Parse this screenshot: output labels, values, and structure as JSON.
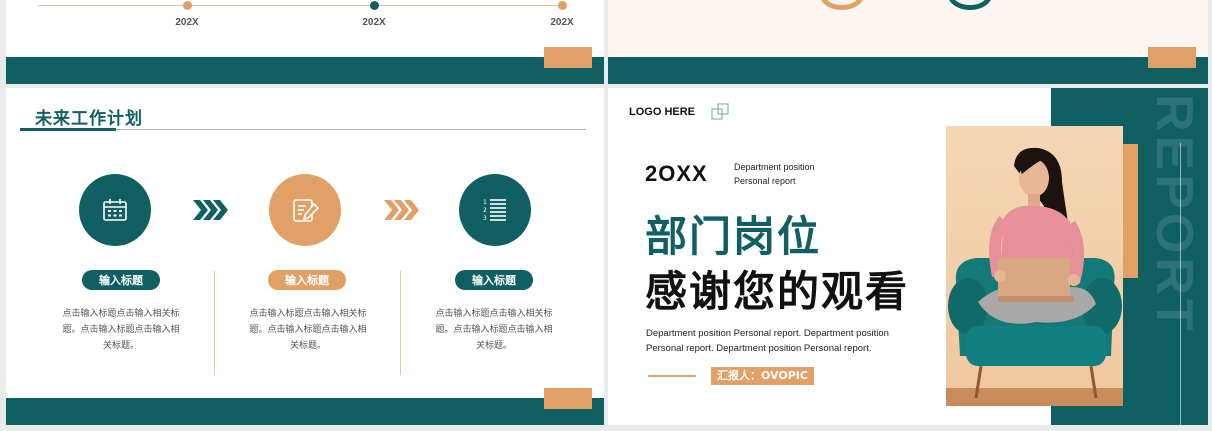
{
  "colors": {
    "teal": "#0f5f63",
    "peach": "#e0a066",
    "cream": "#fbf6f1"
  },
  "timeline": {
    "years": [
      "202X",
      "202X",
      "202X"
    ]
  },
  "plan": {
    "title": "未来工作计划",
    "items": [
      {
        "icon": "calendar-icon",
        "label": "输入标题",
        "desc": "点击输入标题点击输入相关标题。点击输入标题点击输入相关标题。"
      },
      {
        "icon": "edit-icon",
        "label": "输入标题",
        "desc": "点击输入标题点击输入相关标题。点击输入标题点击输入相关标题。"
      },
      {
        "icon": "list-icon",
        "label": "输入标题",
        "desc": "点击输入标题点击输入相关标题。点击输入标题点击输入相关标题。"
      }
    ]
  },
  "closing": {
    "logo": "LOGO HERE",
    "year": "2OXX",
    "dept_line1": "Department position",
    "dept_line2": "Personal report",
    "headline1": "部门岗位",
    "headline2": "感谢您的观看",
    "paragraph": "Department position Personal report. Department position Personal report. Department position Personal report.",
    "reporter": "汇报人：OVOPIC",
    "watermark": "REPORT"
  }
}
